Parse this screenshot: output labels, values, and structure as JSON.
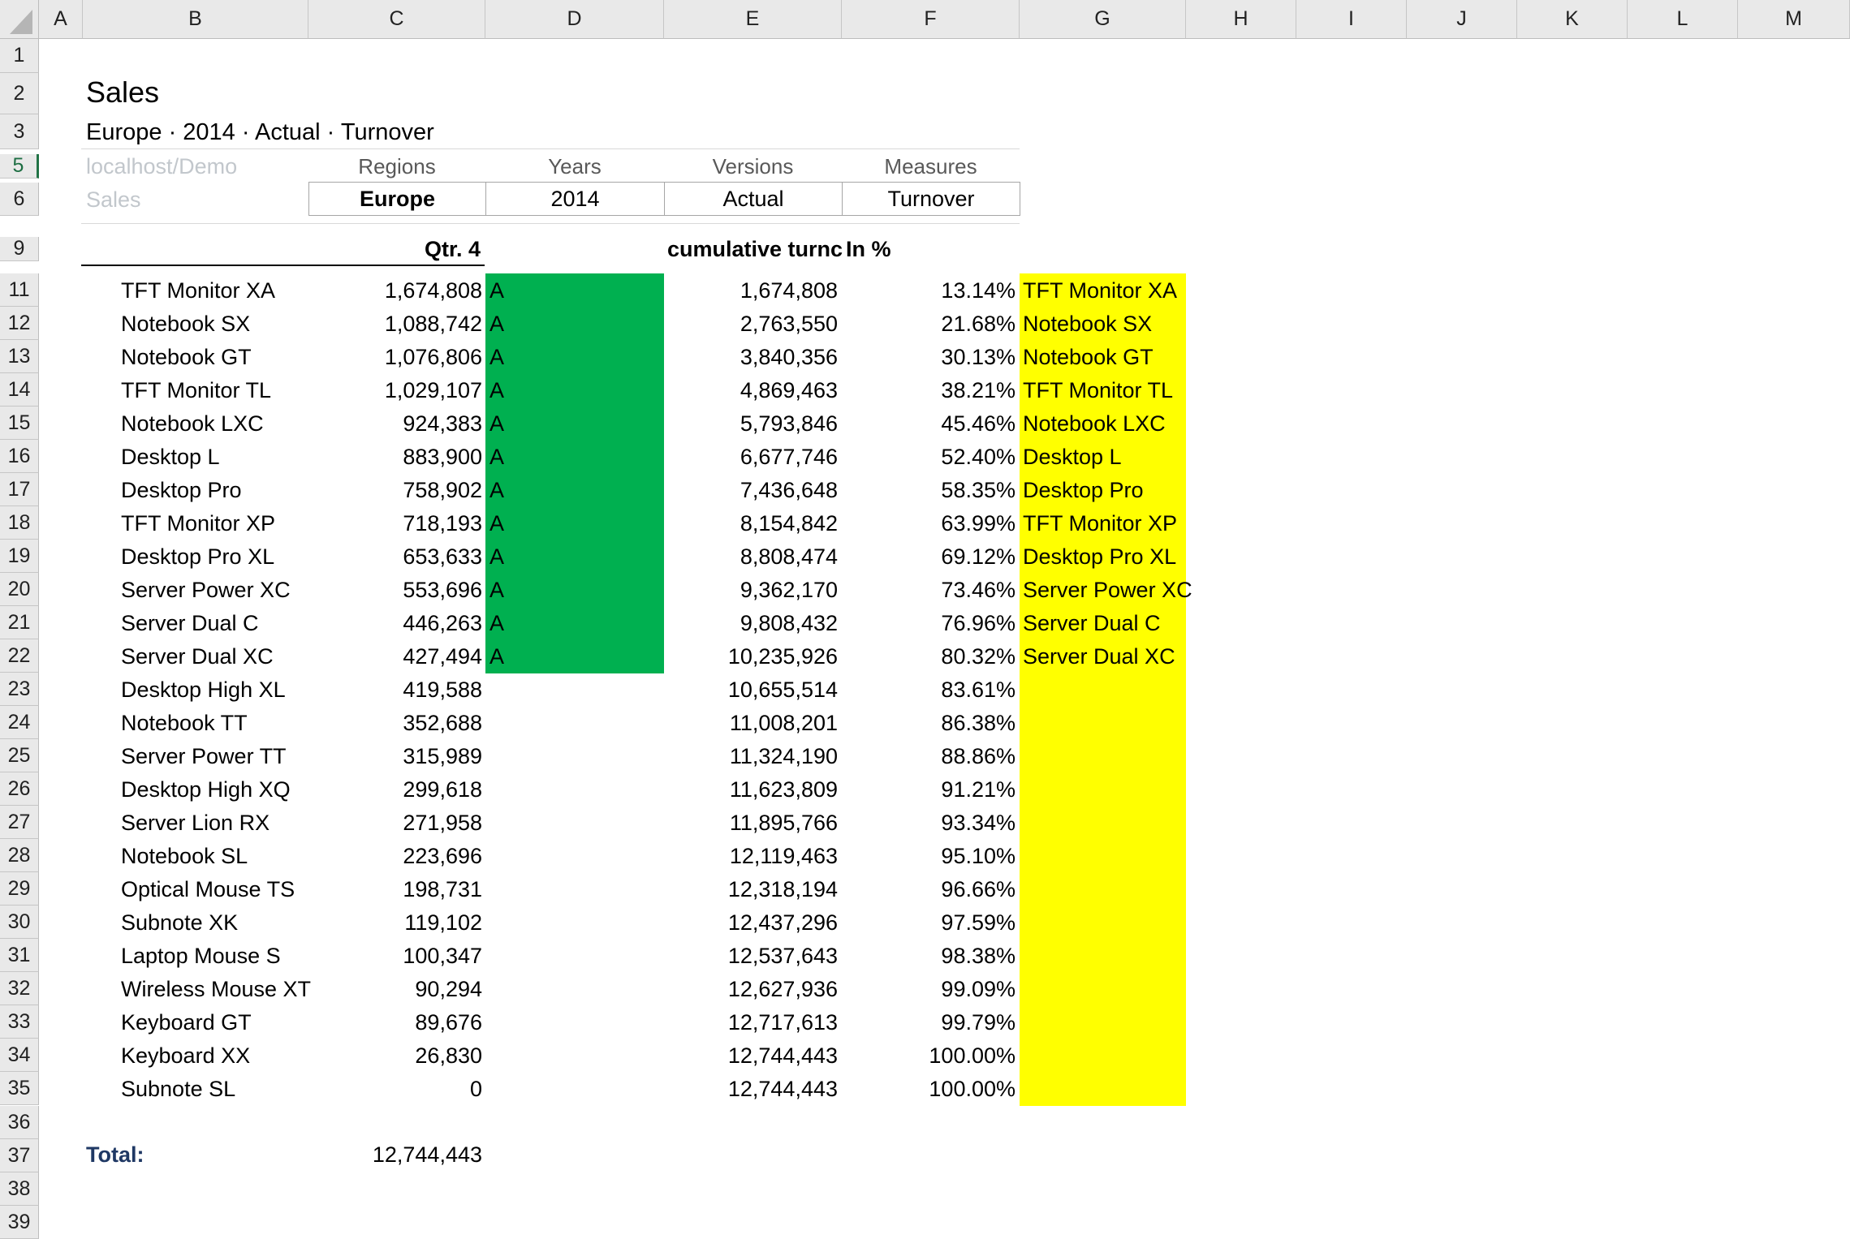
{
  "columns": [
    "A",
    "B",
    "C",
    "D",
    "E",
    "F",
    "G",
    "H",
    "I",
    "J",
    "K",
    "L",
    "M"
  ],
  "rows": [
    "1",
    "2",
    "3",
    "5",
    "6",
    "9",
    "11",
    "12",
    "13",
    "14",
    "15",
    "16",
    "17",
    "18",
    "19",
    "20",
    "21",
    "22",
    "23",
    "24",
    "25",
    "26",
    "27",
    "28",
    "29",
    "30",
    "31",
    "32",
    "33",
    "34",
    "35",
    "36",
    "37",
    "38",
    "39"
  ],
  "active_row": "5",
  "report": {
    "title": "Sales",
    "subtitle": "Europe · 2014 · Actual · Turnover"
  },
  "selector": {
    "server": "localhost/Demo",
    "cube": "Sales",
    "dimensions": [
      {
        "label": "Regions",
        "value": "Europe"
      },
      {
        "label": "Years",
        "value": "2014"
      },
      {
        "label": "Versions",
        "value": "Actual"
      },
      {
        "label": "Measures",
        "value": "Turnover"
      }
    ]
  },
  "table": {
    "headers": {
      "qtr": "Qtr. 4",
      "cumulative": "cumulative turnc",
      "percent": "In %"
    },
    "class_marker": "A",
    "rows": [
      {
        "name": "TFT Monitor XA",
        "value": "1,674,808",
        "cum": "1,674,808",
        "pct": "13.14%",
        "cls": "A",
        "a_item": "TFT Monitor XA"
      },
      {
        "name": "Notebook SX",
        "value": "1,088,742",
        "cum": "2,763,550",
        "pct": "21.68%",
        "cls": "A",
        "a_item": "Notebook SX"
      },
      {
        "name": "Notebook GT",
        "value": "1,076,806",
        "cum": "3,840,356",
        "pct": "30.13%",
        "cls": "A",
        "a_item": "Notebook GT"
      },
      {
        "name": "TFT Monitor TL",
        "value": "1,029,107",
        "cum": "4,869,463",
        "pct": "38.21%",
        "cls": "A",
        "a_item": "TFT Monitor TL"
      },
      {
        "name": "Notebook LXC",
        "value": "924,383",
        "cum": "5,793,846",
        "pct": "45.46%",
        "cls": "A",
        "a_item": "Notebook LXC"
      },
      {
        "name": "Desktop L",
        "value": "883,900",
        "cum": "6,677,746",
        "pct": "52.40%",
        "cls": "A",
        "a_item": "Desktop L"
      },
      {
        "name": "Desktop Pro",
        "value": "758,902",
        "cum": "7,436,648",
        "pct": "58.35%",
        "cls": "A",
        "a_item": "Desktop Pro"
      },
      {
        "name": "TFT Monitor XP",
        "value": "718,193",
        "cum": "8,154,842",
        "pct": "63.99%",
        "cls": "A",
        "a_item": "TFT Monitor XP"
      },
      {
        "name": "Desktop Pro XL",
        "value": "653,633",
        "cum": "8,808,474",
        "pct": "69.12%",
        "cls": "A",
        "a_item": "Desktop Pro XL"
      },
      {
        "name": "Server Power XC",
        "value": "553,696",
        "cum": "9,362,170",
        "pct": "73.46%",
        "cls": "A",
        "a_item": "Server Power XC"
      },
      {
        "name": "Server Dual C",
        "value": "446,263",
        "cum": "9,808,432",
        "pct": "76.96%",
        "cls": "A",
        "a_item": "Server Dual C"
      },
      {
        "name": "Server Dual XC",
        "value": "427,494",
        "cum": "10,235,926",
        "pct": "80.32%",
        "cls": "A",
        "a_item": "Server Dual XC"
      },
      {
        "name": "Desktop High XL",
        "value": "419,588",
        "cum": "10,655,514",
        "pct": "83.61%",
        "cls": "",
        "a_item": ""
      },
      {
        "name": "Notebook TT",
        "value": "352,688",
        "cum": "11,008,201",
        "pct": "86.38%",
        "cls": "",
        "a_item": ""
      },
      {
        "name": "Server Power TT",
        "value": "315,989",
        "cum": "11,324,190",
        "pct": "88.86%",
        "cls": "",
        "a_item": ""
      },
      {
        "name": "Desktop High XQ",
        "value": "299,618",
        "cum": "11,623,809",
        "pct": "91.21%",
        "cls": "",
        "a_item": ""
      },
      {
        "name": "Server Lion RX",
        "value": "271,958",
        "cum": "11,895,766",
        "pct": "93.34%",
        "cls": "",
        "a_item": ""
      },
      {
        "name": "Notebook SL",
        "value": "223,696",
        "cum": "12,119,463",
        "pct": "95.10%",
        "cls": "",
        "a_item": ""
      },
      {
        "name": "Optical Mouse TS",
        "value": "198,731",
        "cum": "12,318,194",
        "pct": "96.66%",
        "cls": "",
        "a_item": ""
      },
      {
        "name": "Subnote XK",
        "value": "119,102",
        "cum": "12,437,296",
        "pct": "97.59%",
        "cls": "",
        "a_item": ""
      },
      {
        "name": "Laptop Mouse S",
        "value": "100,347",
        "cum": "12,537,643",
        "pct": "98.38%",
        "cls": "",
        "a_item": ""
      },
      {
        "name": "Wireless Mouse XT",
        "value": "90,294",
        "cum": "12,627,936",
        "pct": "99.09%",
        "cls": "",
        "a_item": ""
      },
      {
        "name": "Keyboard GT",
        "value": "89,676",
        "cum": "12,717,613",
        "pct": "99.79%",
        "cls": "",
        "a_item": ""
      },
      {
        "name": "Keyboard XX",
        "value": "26,830",
        "cum": "12,744,443",
        "pct": "100.00%",
        "cls": "",
        "a_item": ""
      },
      {
        "name": "Subnote SL",
        "value": "0",
        "cum": "12,744,443",
        "pct": "100.00%",
        "cls": "",
        "a_item": ""
      }
    ],
    "total_label": "Total:",
    "total_value": "12,744,443"
  },
  "colors": {
    "a_class_fill": "#00b050",
    "a_item_fill": "#ffff00",
    "total_label": "#1f3864",
    "header_bg": "#e9e9e9"
  }
}
